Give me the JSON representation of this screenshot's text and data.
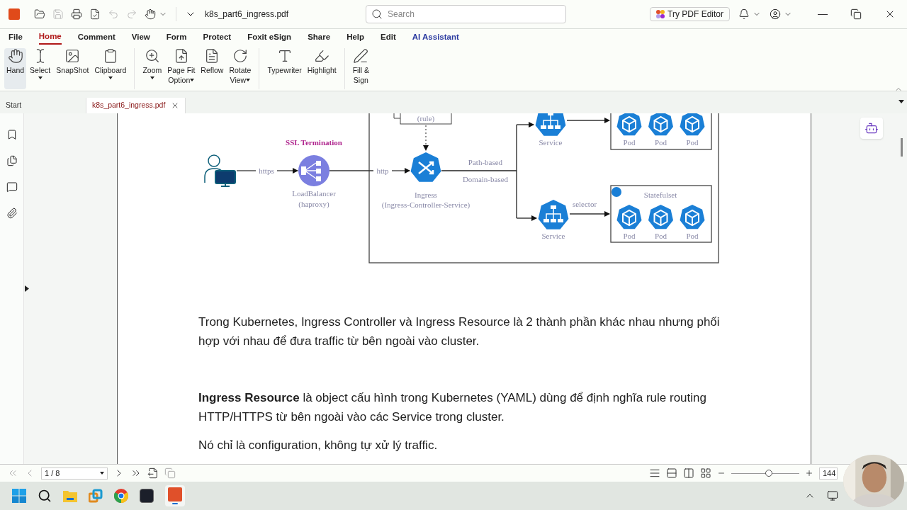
{
  "title_bar": {
    "file_name": "k8s_part6_ingress.pdf",
    "search": {
      "placeholder": "Search"
    },
    "promo_button": "Try PDF Editor"
  },
  "menu": [
    {
      "label": "File",
      "selected": false,
      "kind": "tab"
    },
    {
      "label": "Home",
      "selected": true,
      "kind": "tab"
    },
    {
      "label": "Comment",
      "selected": false,
      "kind": "tab"
    },
    {
      "label": "View",
      "selected": false,
      "kind": "tab"
    },
    {
      "label": "Form",
      "selected": false,
      "kind": "tab"
    },
    {
      "label": "Protect",
      "selected": false,
      "kind": "tab"
    },
    {
      "label": "Foxit eSign",
      "selected": false,
      "kind": "tab"
    },
    {
      "label": "Share",
      "selected": false,
      "kind": "tab"
    },
    {
      "label": "Help",
      "selected": false,
      "kind": "tab"
    },
    {
      "label": "Edit",
      "selected": false,
      "kind": "tab"
    },
    {
      "label": "AI Assistant",
      "selected": false,
      "kind": "assistant"
    }
  ],
  "ribbon": [
    [
      {
        "lines": [
          "Hand"
        ],
        "selected": true,
        "dropdown": false
      },
      {
        "lines": [
          "Select"
        ],
        "selected": false,
        "dropdown": true
      },
      {
        "lines": [
          "SnapShot"
        ],
        "selected": false,
        "dropdown": false
      },
      {
        "lines": [
          "Clipboard"
        ],
        "selected": false,
        "dropdown": true
      }
    ],
    [
      {
        "lines": [
          "Zoom"
        ],
        "selected": false,
        "dropdown": true
      },
      {
        "lines": [
          "Page Fit",
          "Option"
        ],
        "selected": false,
        "dropdown": true
      },
      {
        "lines": [
          "Reflow"
        ],
        "selected": false,
        "dropdown": false
      },
      {
        "lines": [
          "Rotate",
          "View"
        ],
        "selected": false,
        "dropdown": true
      }
    ],
    [
      {
        "lines": [
          "Typewriter"
        ],
        "selected": false,
        "dropdown": false
      },
      {
        "lines": [
          "Highlight"
        ],
        "selected": false,
        "dropdown": false
      }
    ],
    [
      {
        "lines": [
          "Fill &",
          "Sign"
        ],
        "selected": false,
        "dropdown": false
      }
    ]
  ],
  "doc_tabs": [
    {
      "label": "Start",
      "selected": false
    },
    {
      "label": "k8s_part6_ingress.pdf",
      "selected": true
    }
  ],
  "diagram": {
    "rule_label": "(rule)",
    "ssl_label": "SSL Termination",
    "edges": [
      "https",
      "http"
    ],
    "load_balancer": {
      "name": "LoadBalancer",
      "detail": "(haproxy)"
    },
    "ingress": {
      "name": "Ingress",
      "detail": "(Ingress-Controller-Service)"
    },
    "routing": [
      "Path-based",
      "Domain-based"
    ],
    "services": [
      {
        "label": "Service",
        "pods": [
          "Pod",
          "Pod",
          "Pod"
        ]
      },
      {
        "label": "Service",
        "selector": "selector",
        "group": "Statefulset",
        "pods": [
          "Pod",
          "Pod",
          "Pod"
        ]
      }
    ]
  },
  "paragraphs": [
    {
      "text": "Trong Kubernetes, Ingress Controller và Ingress Resource là 2 thành phần khác nhau nhưng phối hợp với nhau để đưa traffic từ bên ngoài vào cluster."
    },
    {
      "text": "**Ingress Resource** là object cấu hình trong Kubernetes (YAML) dùng để định nghĩa rule routing HTTP/HTTPS từ bên ngoài vào các Service trong cluster."
    },
    {
      "text": "Nó chỉ là configuration, không tự xử lý traffic."
    }
  ],
  "status_bar": {
    "page_field": "1 / 8",
    "zoom": {
      "level": 0.55,
      "value": "144"
    }
  }
}
